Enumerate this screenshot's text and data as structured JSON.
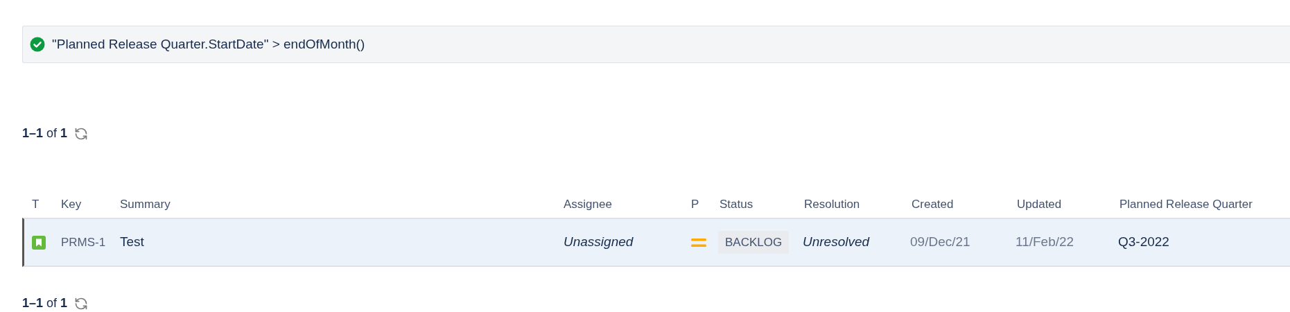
{
  "query_bar": {
    "kind": "valid",
    "text": "\"Planned Release Quarter.StartDate\" > endOfMonth()"
  },
  "pagination_top": {
    "text": "**1–1** of **1**"
  },
  "table": {
    "columns": [
      "T",
      "Key",
      "Summary",
      "Assignee",
      "P",
      "Status",
      "Resolution",
      "Created",
      "Updated",
      "Planned Release Quarter"
    ],
    "rows": [
      {
        "selected": true,
        "issue_type": {
          "kind": "story"
        },
        "key": "PRMS-1",
        "summary": "Test",
        "assignee": "Unassigned",
        "priority": {
          "kind": "medium"
        },
        "status": "BACKLOG",
        "resolution": "Unresolved",
        "created": "09/Dec/21",
        "updated": "11/Feb/22",
        "planned_release_quarter": "Q3-2022"
      }
    ]
  },
  "pagination_bottom": {
    "text": "**1–1** of **1**"
  }
}
